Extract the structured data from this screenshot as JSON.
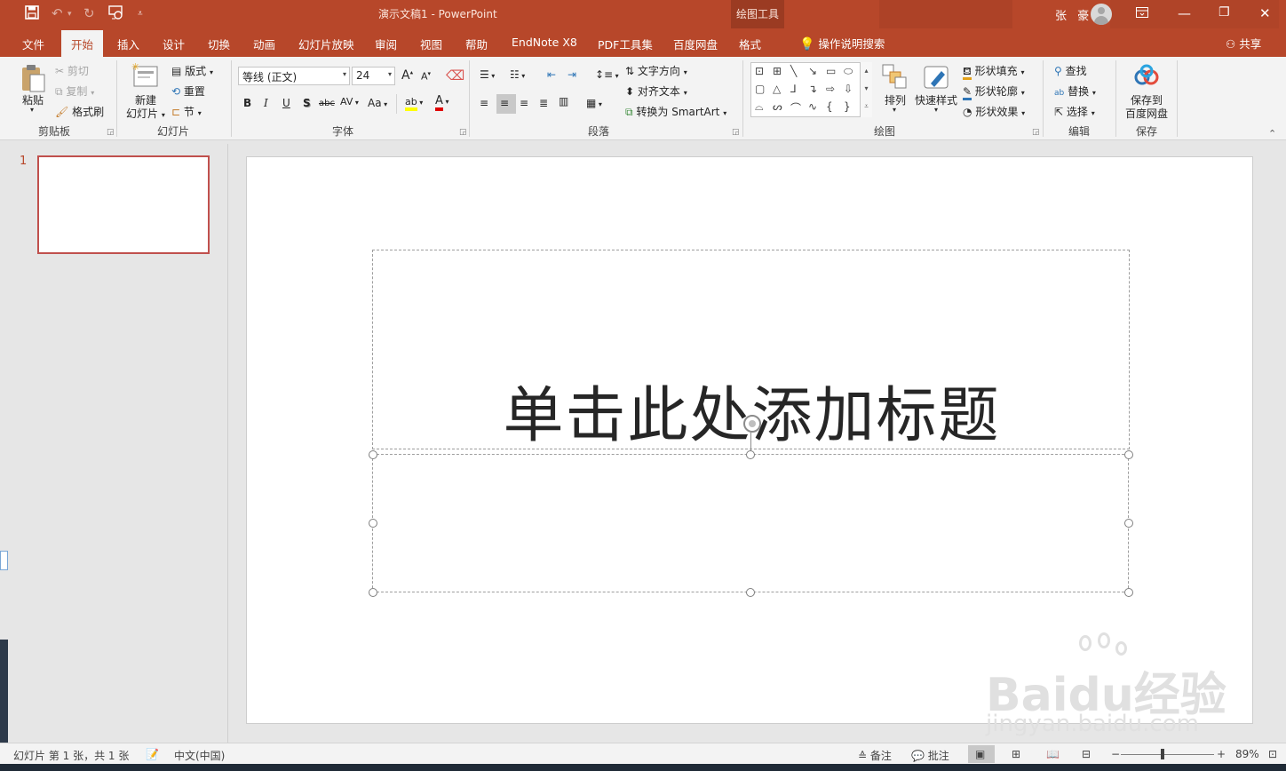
{
  "app": {
    "document_title": "演示文稿1  -  PowerPoint",
    "contextual_tab_group": "绘图工具",
    "user_name": "张 豪"
  },
  "qat": {
    "save_icon": "floppy-save-icon",
    "undo_icon": "undo-icon",
    "redo_icon": "redo-icon",
    "present_icon": "present-from-start-icon",
    "customize_icon": "qat-customize-icon"
  },
  "window_controls": {
    "ribbon_display_icon": "ribbon-display-options-icon",
    "minimize": "—",
    "restore": "❐",
    "close": "✕"
  },
  "tabs": [
    "文件",
    "开始",
    "插入",
    "设计",
    "切换",
    "动画",
    "幻灯片放映",
    "审阅",
    "视图",
    "帮助",
    "EndNote X8",
    "PDF工具集",
    "百度网盘",
    "格式"
  ],
  "tell_me": "操作说明搜索",
  "share": "共享",
  "ribbon": {
    "clipboard": {
      "group": "剪贴板",
      "paste": "粘贴",
      "cut": "剪切",
      "copy": "复制",
      "format_painter": "格式刷"
    },
    "slides": {
      "group": "幻灯片",
      "new_slide_line1": "新建",
      "new_slide_line2": "幻灯片",
      "layout": "版式",
      "reset": "重置",
      "section": "节"
    },
    "font": {
      "group": "字体",
      "font_name": "等线 (正文)",
      "font_size": "24",
      "bold": "B",
      "italic": "I",
      "underline": "U",
      "shadow": "S",
      "strike": "abc",
      "spacing": "AV",
      "case": "Aa",
      "grow": "A",
      "shrink": "A",
      "color_letter": "A"
    },
    "paragraph": {
      "group": "段落",
      "text_direction": "文字方向",
      "align_text": "对齐文本",
      "smartart": "转换为 SmartArt"
    },
    "drawing": {
      "group": "绘图",
      "arrange": "排列",
      "quick_styles": "快速样式",
      "shape_fill": "形状填充",
      "shape_outline": "形状轮廓",
      "shape_effects": "形状效果"
    },
    "editing": {
      "group": "编辑",
      "find": "查找",
      "replace": "替换",
      "select": "选择"
    },
    "save": {
      "group": "保存",
      "save_to_line1": "保存到",
      "save_to_line2": "百度网盘"
    }
  },
  "thumbnail": {
    "number": "1"
  },
  "slide": {
    "title_placeholder": "单击此处添加标题"
  },
  "watermark": {
    "brand": "Baidu经验",
    "url": "jingyan.baidu.com"
  },
  "status": {
    "slide_info": "幻灯片 第 1 张，共 1 张",
    "language": "中文(中国)",
    "notes": "备注",
    "comments": "批注",
    "zoom_minus": "−",
    "zoom_plus": "+",
    "zoom": "89%"
  }
}
